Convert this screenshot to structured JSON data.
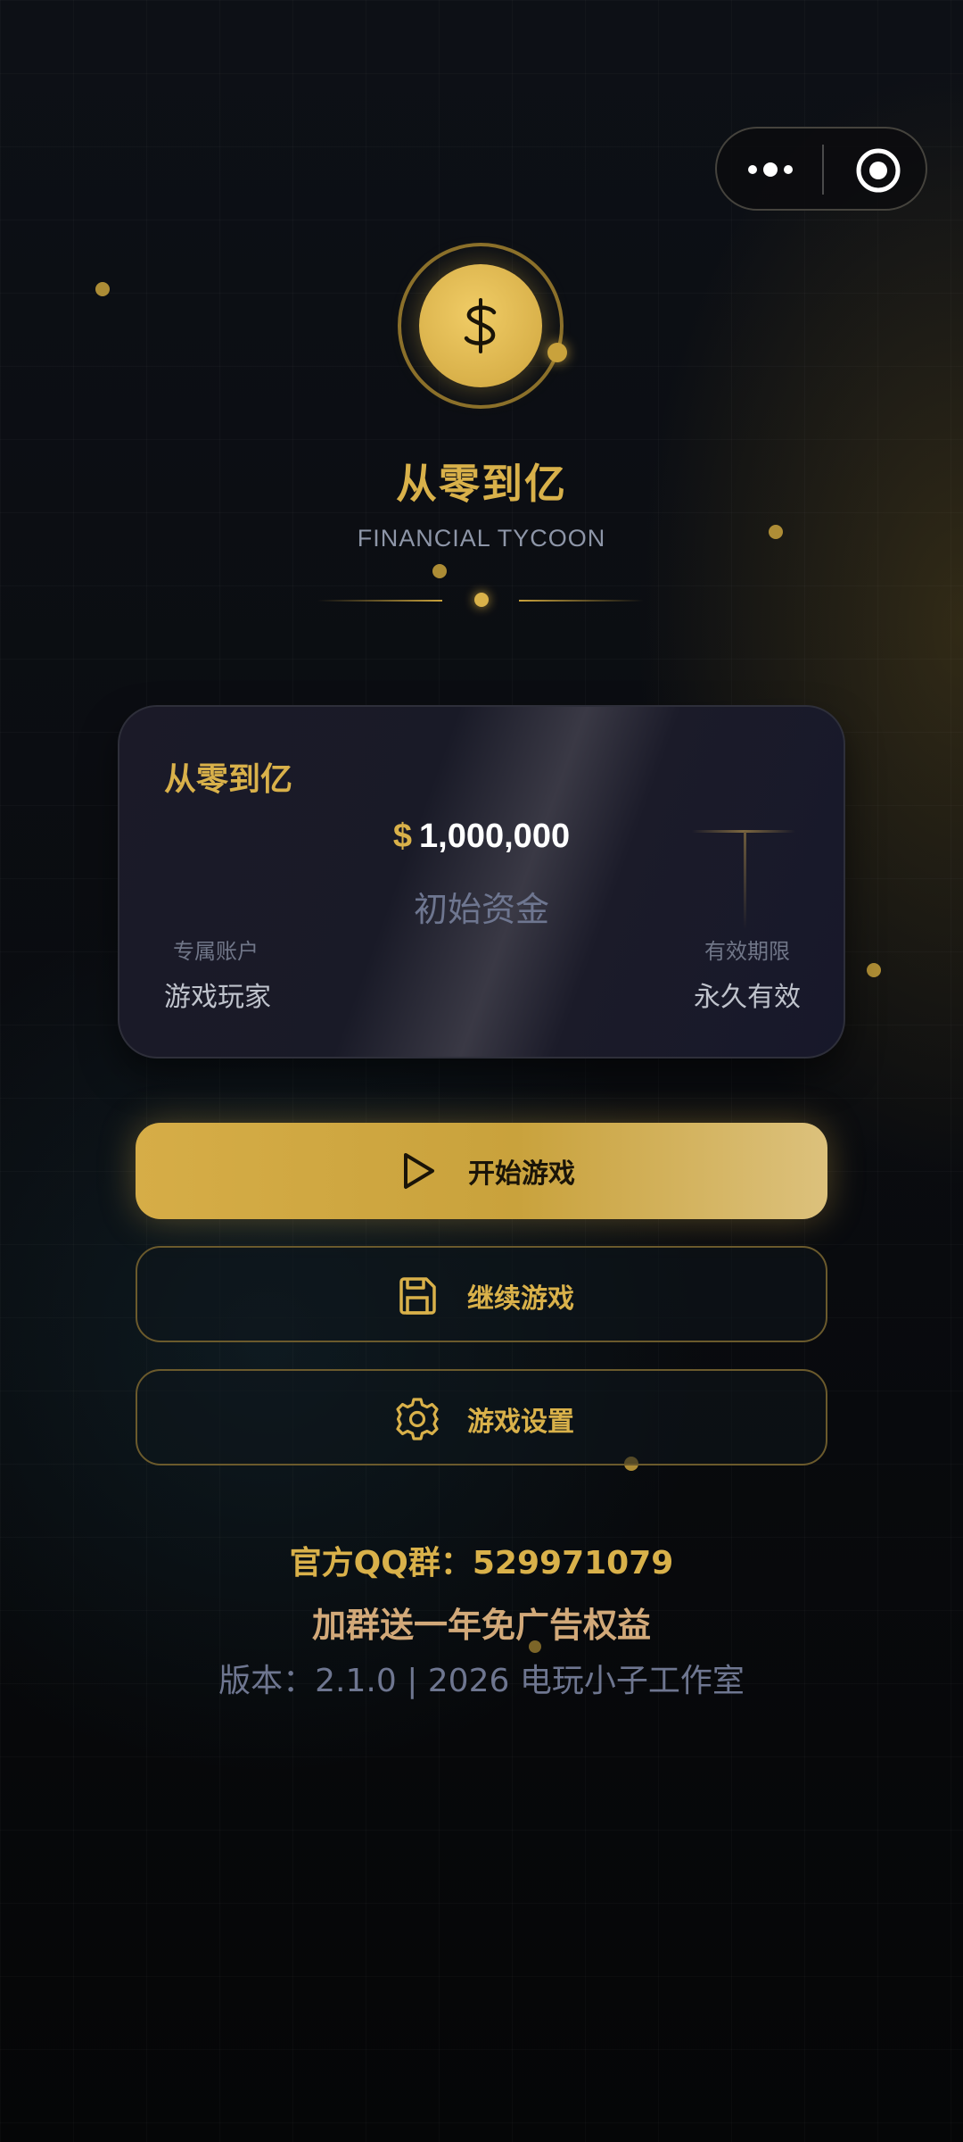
{
  "app": {
    "title": "从零到亿",
    "subtitle": "FINANCIAL TYCOON"
  },
  "capsule": {
    "more_icon": "more-dots-icon",
    "close_icon": "target-close-icon"
  },
  "logo": {
    "icon": "dollar-icon"
  },
  "card": {
    "name": "从零到亿",
    "currency_symbol": "$",
    "amount": "1,000,000",
    "caption": "初始资金",
    "left_label": "专属账户",
    "left_value": "游戏玩家",
    "right_label": "有效期限",
    "right_value": "永久有效"
  },
  "buttons": {
    "start": {
      "label": "开始游戏",
      "icon": "play-icon"
    },
    "continue": {
      "label": "继续游戏",
      "icon": "save-icon"
    },
    "settings": {
      "label": "游戏设置",
      "icon": "gear-icon"
    }
  },
  "footer": {
    "qq_group": "官方QQ群：529971079",
    "promo": "加群送一年免广告权益",
    "version": "版本：2.1.0 | 2026 电玩小子工作室"
  },
  "colors": {
    "gold": "#d9b14a",
    "background": "#0b0d12",
    "muted": "#6e7690"
  }
}
